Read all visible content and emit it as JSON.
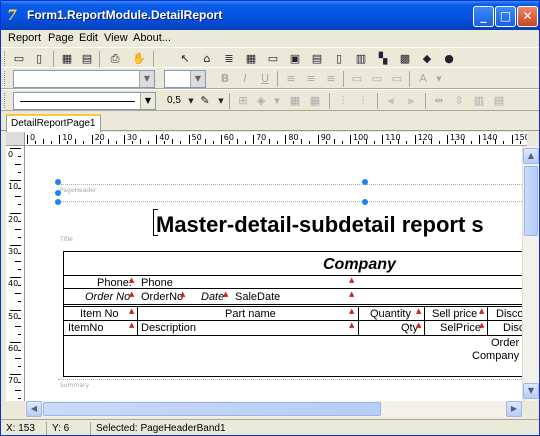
{
  "window": {
    "title": "Form1.ReportModule.DetailReport",
    "app_icon": "7"
  },
  "menu": {
    "items": [
      "Report",
      "Page",
      "Edit",
      "View",
      "About..."
    ]
  },
  "toolbar3": {
    "line_width": "0,5"
  },
  "tabs": [
    {
      "label": "DetailReportPage1"
    }
  ],
  "ruler": {
    "h": [
      "0",
      "10",
      "20",
      "30",
      "40",
      "50",
      "60",
      "70",
      "80",
      "90",
      "100",
      "110",
      "120",
      "130",
      "140",
      "150"
    ],
    "v": [
      "0",
      "10",
      "20",
      "30",
      "40",
      "50",
      "60",
      "70",
      "80"
    ]
  },
  "bands": {
    "page_header": "PageHeader",
    "title": "Title",
    "summary": "Summary"
  },
  "report": {
    "title": "Master-detail-subdetail report s",
    "company": "Company",
    "phone_label": "Phone:",
    "phone_field": "Phone",
    "order_label": "Order No",
    "order_field": "OrderNo",
    "date_label": "Date",
    "date_field": "SaleDate",
    "col_item": "Item No",
    "col_part": "Part name",
    "col_qty": "Quantity",
    "col_price": "Sell price",
    "col_disc": "Disco",
    "f_item": "ItemNo",
    "f_desc": "Description",
    "f_qty": "Qty",
    "f_price": "SelPrice",
    "f_disc": "Disc",
    "foot_order": "Order",
    "foot_company": "Company"
  },
  "status": {
    "x": "X: 153",
    "y": "Y: 6",
    "selected": "Selected: PageHeaderBand1"
  }
}
